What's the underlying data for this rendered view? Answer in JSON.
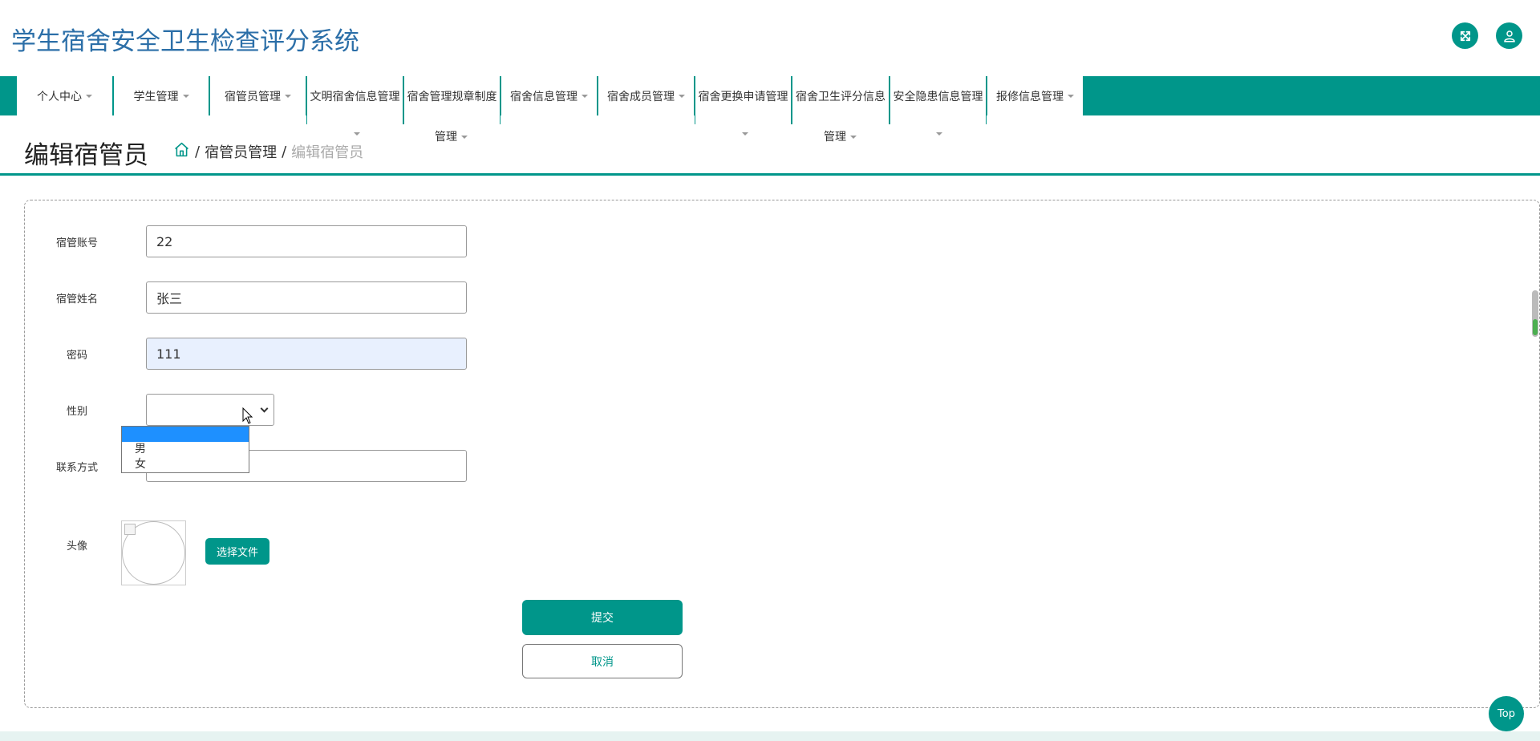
{
  "app": {
    "title": "学生宿舍安全卫生检查评分系统"
  },
  "header": {
    "fullscreen_icon": "expand-arrows-icon",
    "user_icon": "user-icon"
  },
  "nav": {
    "items": [
      {
        "label": "个人中心"
      },
      {
        "label": "学生管理"
      },
      {
        "label": "宿管员管理"
      },
      {
        "label": "文明宿舍信息管理"
      },
      {
        "label": "宿舍管理规章制度",
        "label_line2": "管理"
      },
      {
        "label": "宿舍信息管理"
      },
      {
        "label": "宿舍成员管理"
      },
      {
        "label": "宿舍更换申请管理"
      },
      {
        "label": "宿舍卫生评分信息",
        "label_line2": "管理"
      },
      {
        "label": "安全隐患信息管理"
      },
      {
        "label": "报修信息管理"
      }
    ]
  },
  "page": {
    "title": "编辑宿管员",
    "breadcrumb": {
      "sep": "/",
      "parent": "宿管员管理",
      "current": "编辑宿管员"
    }
  },
  "form": {
    "account": {
      "label": "宿管账号",
      "value": "22"
    },
    "name": {
      "label": "宿管姓名",
      "value": "张三"
    },
    "password": {
      "label": "密码",
      "value": "111"
    },
    "gender": {
      "label": "性别",
      "value": "",
      "options": [
        "",
        "男",
        "女"
      ]
    },
    "contact": {
      "label": "联系方式",
      "value": ""
    },
    "avatar": {
      "label": "头像",
      "file_button": "选择文件"
    },
    "submit": "提交",
    "cancel": "取消"
  },
  "floating": {
    "top_button": "Top"
  },
  "colors": {
    "accent": "#00968a",
    "title_blue": "#2c6fa8",
    "select_highlight": "#1e90ff"
  }
}
